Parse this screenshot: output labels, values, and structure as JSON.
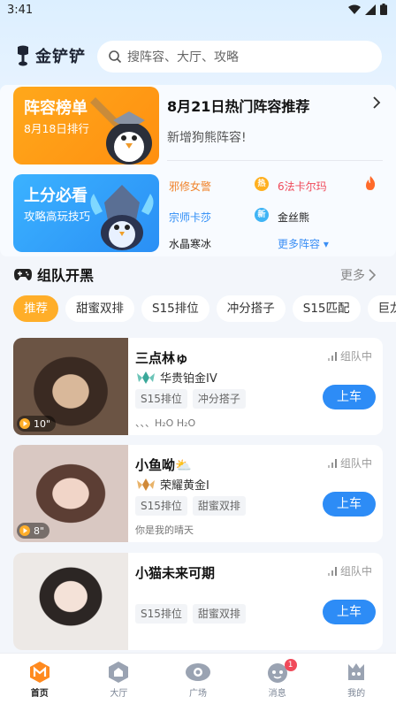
{
  "status_bar": {
    "time": "3:41"
  },
  "header": {
    "app_name": "金铲铲",
    "search_placeholder": "搜阵容、大厅、攻略"
  },
  "banners": [
    {
      "title": "阵容榜单",
      "subtitle": "8月18日排行"
    },
    {
      "title": "上分必看",
      "subtitle": "攻略高玩技巧"
    }
  ],
  "recommend": {
    "title": "8月21日热门阵容推荐",
    "subtitle": "新增狗熊阵容!",
    "comps": [
      {
        "name": "邪修女警",
        "color": "#f0832a",
        "badge": "热",
        "badge_color": "#ffb020"
      },
      {
        "name": "6法卡尔玛",
        "color": "#f04a5a",
        "badge": "",
        "badge_color": "#ff6a2a"
      },
      {
        "name": "宗师卡莎",
        "color": "#2d8cf6",
        "badge": "新",
        "badge_color": "#3fb4f5"
      },
      {
        "name": "金丝熊",
        "color": "#222222",
        "badge": "",
        "badge_color": ""
      },
      {
        "name": "水晶寒冰",
        "color": "#222222",
        "badge": "",
        "badge_color": ""
      }
    ],
    "more_label": "更多阵容 ▾"
  },
  "team_section": {
    "title": "组队开黑",
    "more_label": "更多",
    "chips": [
      "推荐",
      "甜蜜双排",
      "S15排位",
      "冲分搭子",
      "S15匹配",
      "巨龙"
    ]
  },
  "cards": [
    {
      "name": "三点林ゅ",
      "status": "组队中",
      "rank": "华贵铂金IV",
      "tags": [
        "S15排位",
        "冲分搭子"
      ],
      "bio": "、、、H₂O H₂O",
      "duration": "10\"",
      "join_label": "上车"
    },
    {
      "name": "小鱼呦⛅",
      "status": "组队中",
      "rank": "荣耀黄金I",
      "tags": [
        "S15排位",
        "甜蜜双排"
      ],
      "bio": "你是我的晴天",
      "duration": "8\"",
      "join_label": "上车"
    },
    {
      "name": "小猫未来可期",
      "status": "组队中",
      "rank": "",
      "tags": [
        "S15排位",
        "甜蜜双排"
      ],
      "bio": "",
      "duration": "",
      "join_label": "上车"
    }
  ],
  "tabbar": {
    "items": [
      {
        "label": "首页",
        "icon": "home-icon",
        "active": true
      },
      {
        "label": "大厅",
        "icon": "lobby-icon",
        "active": false
      },
      {
        "label": "广场",
        "icon": "plaza-icon",
        "active": false
      },
      {
        "label": "消息",
        "icon": "message-icon",
        "active": false,
        "badge": "1"
      },
      {
        "label": "我的",
        "icon": "profile-icon",
        "active": false
      }
    ]
  },
  "colors": {
    "accent_orange": "#ffae29",
    "accent_blue": "#2d8cf6"
  }
}
